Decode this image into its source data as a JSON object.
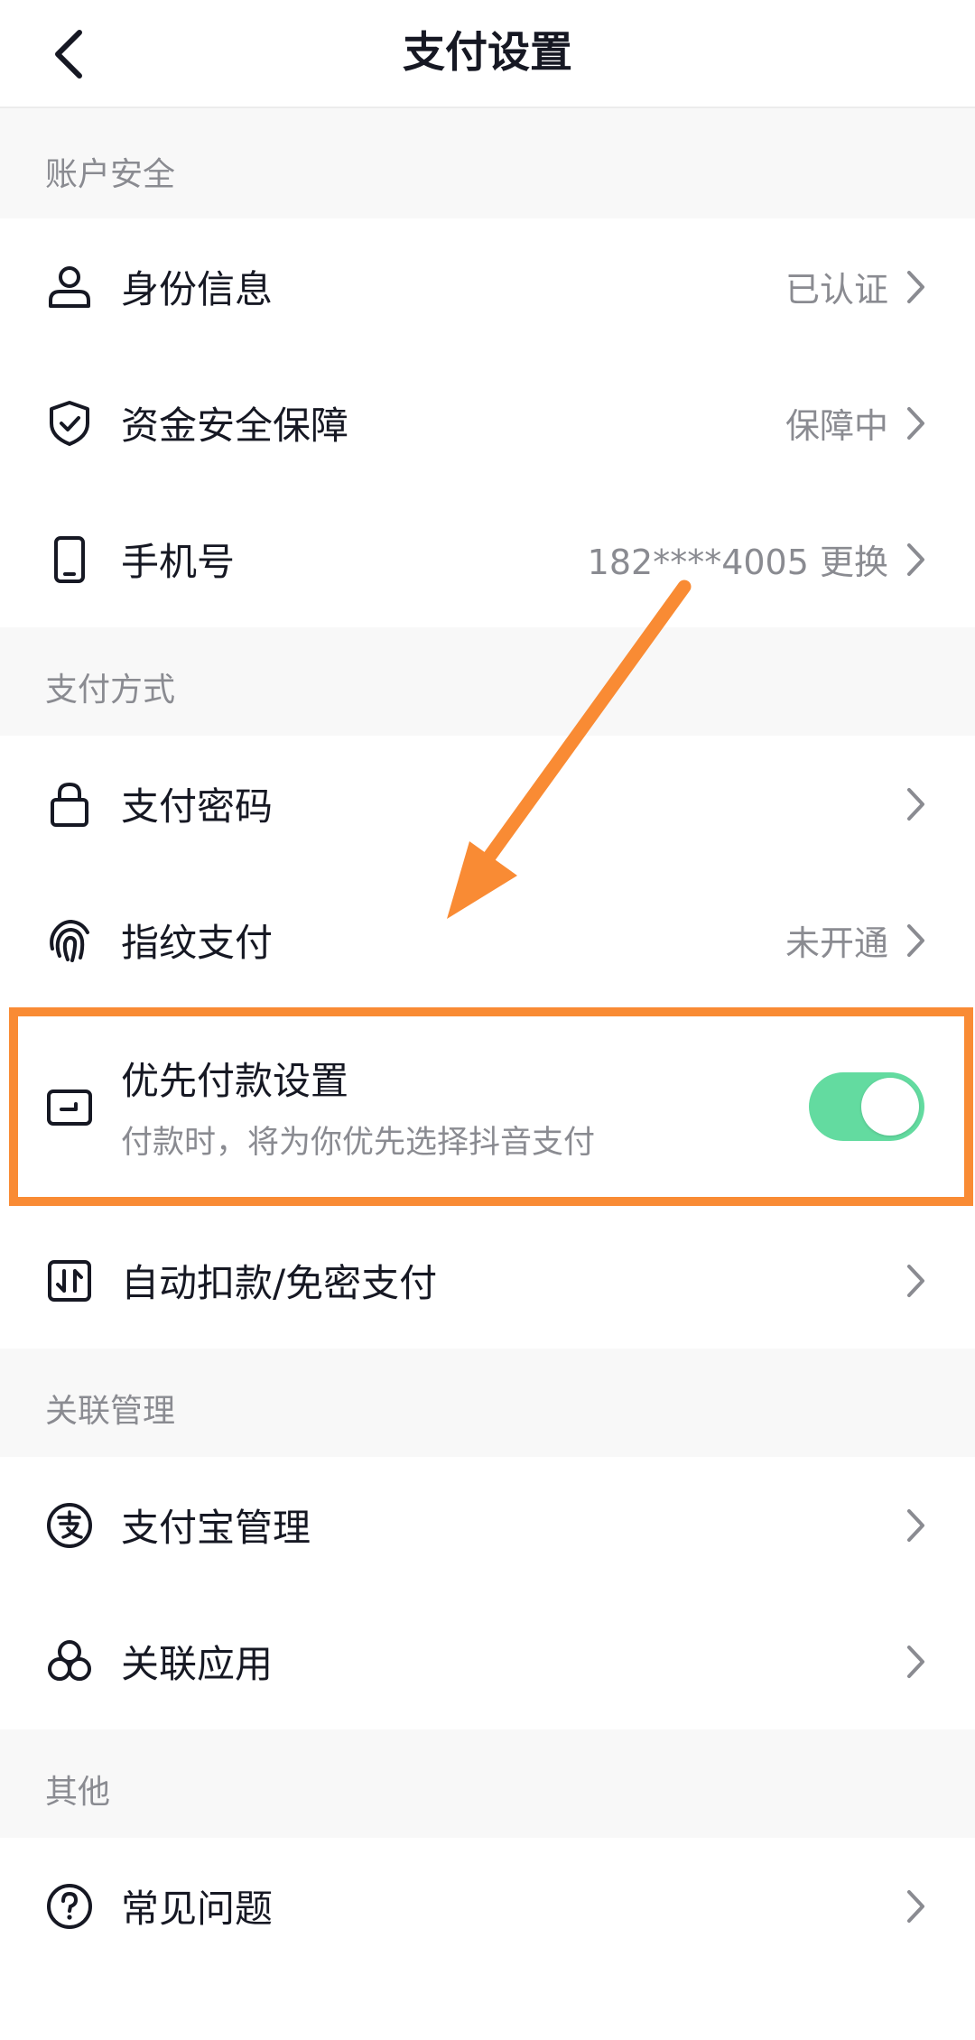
{
  "header": {
    "title": "支付设置",
    "back_icon": "chevron-left-icon"
  },
  "sections": {
    "account": {
      "title": "账户安全",
      "items": [
        {
          "icon": "user-icon",
          "label": "身份信息",
          "value": "已认证"
        },
        {
          "icon": "shield-check-icon",
          "label": "资金安全保障",
          "value": "保障中"
        },
        {
          "icon": "phone-icon",
          "label": "手机号",
          "value": "182****4005 更换"
        }
      ]
    },
    "payment": {
      "title": "支付方式",
      "items": [
        {
          "icon": "lock-icon",
          "label": "支付密码",
          "value": ""
        },
        {
          "icon": "fingerprint-icon",
          "label": "指纹支付",
          "value": "未开通"
        }
      ],
      "priority": {
        "icon": "wallet-icon",
        "label": "优先付款设置",
        "subtitle": "付款时，将为你优先选择抖音支付",
        "enabled": true
      },
      "auto": {
        "icon": "auto-pay-icon",
        "label": "自动扣款/免密支付",
        "value": ""
      }
    },
    "linked": {
      "title": "关联管理",
      "items": [
        {
          "icon": "alipay-icon",
          "label": "支付宝管理",
          "value": ""
        },
        {
          "icon": "linked-apps-icon",
          "label": "关联应用",
          "value": ""
        }
      ]
    },
    "other": {
      "title": "其他",
      "items": [
        {
          "icon": "help-icon",
          "label": "常见问题",
          "value": ""
        }
      ]
    }
  },
  "colors": {
    "toggle_on": "#63dba0",
    "annotation": "#f98b34",
    "text_primary": "#161823",
    "text_secondary": "#8a8b91",
    "section_bg": "#f8f8f8"
  }
}
